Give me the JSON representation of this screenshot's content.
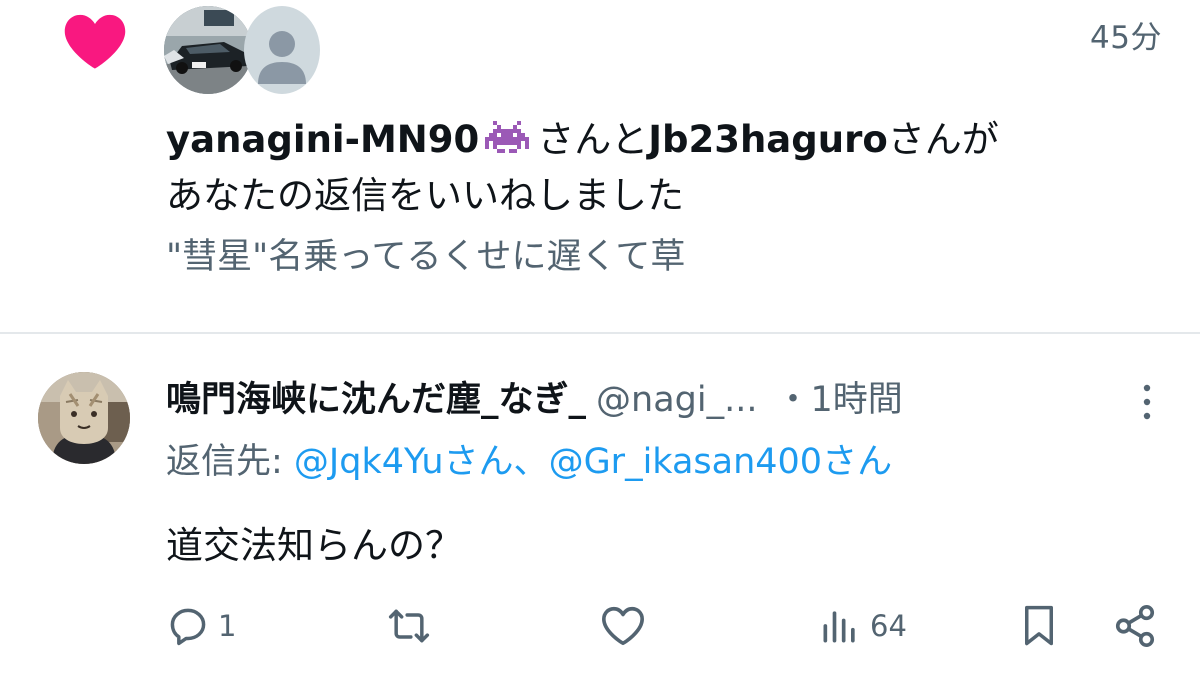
{
  "notification": {
    "time": "45分",
    "user1": "yanagini-MN90",
    "mid_text": "さんと",
    "user2": "Jb23haguro",
    "end_text": "さんが",
    "line2": "あなたの返信をいいねしました",
    "preview": "\"彗星\"名乗ってるくせに遅くて草",
    "icons": {
      "like": "heart-icon",
      "emoji": "space-invader-icon"
    },
    "colors": {
      "heart": "#f91880",
      "emoji": "#9b59b6"
    }
  },
  "tweet": {
    "display_name": "鳴門海峡に沈んだ塵_なぎ_",
    "handle": "@nagi_...",
    "separator": "・",
    "time": "1時間",
    "reply_label": "返信先: ",
    "mention1": "@Jqk4Yuさん",
    "mention_sep": "、",
    "mention2": "@Gr_ikasan400さん",
    "text": "道交法知らんの？",
    "actions": {
      "reply_count": "1",
      "repost_count": "",
      "like_count": "",
      "views_count": "64"
    },
    "colors": {
      "link": "#1d9bf0",
      "secondary": "#536471"
    }
  }
}
